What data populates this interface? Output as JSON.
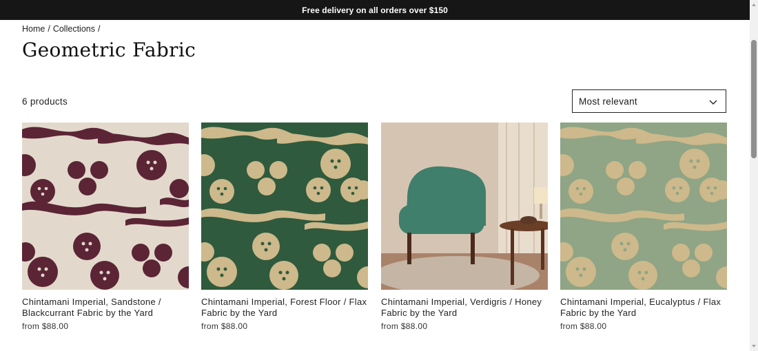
{
  "announcement": {
    "text": "Free delivery on all orders over $150"
  },
  "breadcrumb": {
    "home": "Home",
    "collections": "Collections",
    "separator": "/"
  },
  "page": {
    "title": "Geometric Fabric"
  },
  "toolbar": {
    "product_count": "6 products",
    "sort_selected": "Most relevant",
    "sort_icon": "chevron-down-icon"
  },
  "products": [
    {
      "name": "Chintamani Imperial, Sandstone / Blackcurrant Fabric by the Yard",
      "price": "from $88.00",
      "background": "#e2d9cc",
      "motif": "#5b2536"
    },
    {
      "name": "Chintamani Imperial, Forest Floor / Flax Fabric by the Yard",
      "price": "from $88.00",
      "background": "#2f5a3d",
      "motif": "#cdb98b"
    },
    {
      "name": "Chintamani Imperial, Verdigris / Honey Fabric by the Yard",
      "price": "from $88.00",
      "background": "#d8c3b0",
      "motif": "#3f7f6c"
    },
    {
      "name": "Chintamani Imperial, Eucalyptus / Flax Fabric by the Yard",
      "price": "from $88.00",
      "background": "#8fa585",
      "motif": "#cdb98b"
    }
  ]
}
